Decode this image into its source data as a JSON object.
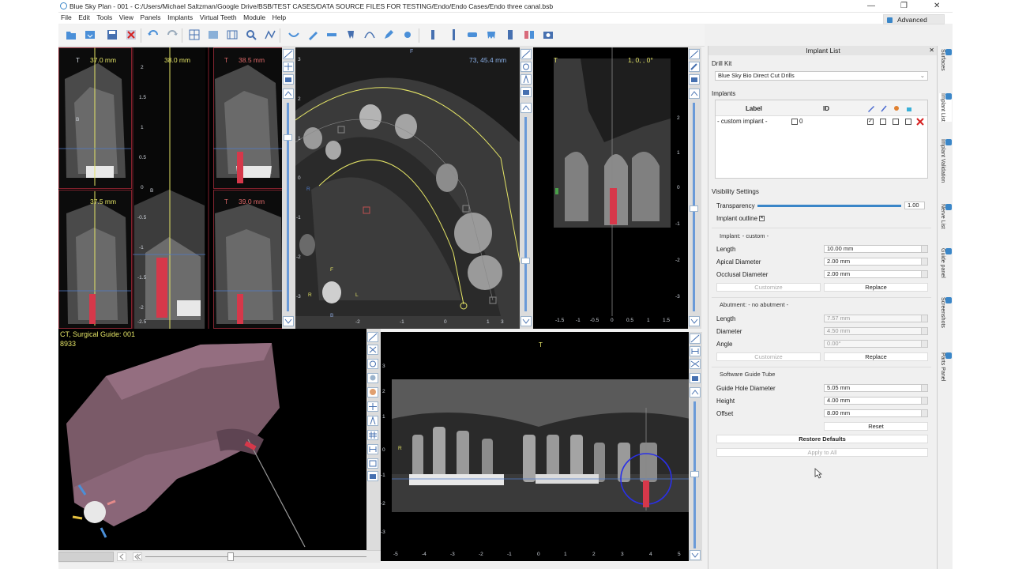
{
  "window": {
    "title": "Blue Sky Plan - 001 - C:/Users/Michael Saltzman/Google Drive/BSB/TEST CASES/DATA SOURCE FILES FOR TESTING/Endo/Endo Cases/Endo three canal.bsb",
    "minimize": "—",
    "restore": "❐",
    "close": "✕"
  },
  "menu": [
    "File",
    "Edit",
    "Tools",
    "View",
    "Panels",
    "Implants",
    "Virtual Teeth",
    "Module",
    "Help"
  ],
  "advanced_label": "Advanced",
  "views": {
    "cross": {
      "measures": [
        "37.0 mm",
        "38.0 mm",
        "38.5 mm",
        "37.5 mm",
        "39.0 mm"
      ],
      "t": "T",
      "b": "B",
      "ticks": [
        "2",
        "1.5",
        "1",
        "0.5",
        "0",
        "-0.5",
        "-1",
        "-1.5",
        "-2",
        "-2.5"
      ]
    },
    "axial": {
      "coord": "73, 45.4 mm",
      "f": "F",
      "r": "R",
      "l": "L",
      "b": "B",
      "ticks_x": [
        "-2",
        "-1",
        "0",
        "1",
        "2",
        "3"
      ],
      "ticks_y": [
        "3",
        "2",
        "1",
        "0",
        "-1",
        "-2",
        "-3"
      ]
    },
    "sagittal": {
      "coord": "1, 0, , 0°",
      "t": "T",
      "ticks_x": [
        "-1.5",
        "-1",
        "-0.5",
        "0",
        "0.5",
        "1",
        "1.5"
      ],
      "ticks_y": [
        "2",
        "1",
        "0",
        "-1",
        "-2",
        "-3"
      ]
    },
    "model3d": {
      "line1": "CT, Surgical Guide: 001",
      "line2": "8933"
    },
    "panoramic": {
      "t": "T",
      "r": "R",
      "ticks_x": [
        "-5",
        "-4",
        "-3",
        "-2",
        "-1",
        "0",
        "1",
        "2",
        "3",
        "4",
        "5"
      ],
      "ticks_y": [
        "3",
        "2",
        "1",
        "0",
        "-1",
        "-2",
        "-3"
      ]
    }
  },
  "panel": {
    "title": "Implant List",
    "drill_kit_label": "Drill Kit",
    "drill_kit_value": "Blue Sky Bio Direct Cut Drills",
    "implants_label": "Implants",
    "col_label": "Label",
    "col_id": "ID",
    "implant_row_label": "- custom implant -",
    "implant_row_id": "0",
    "visibility_title": "Visibility Settings",
    "transparency_label": "Transparency",
    "transparency_value": "1.00",
    "transparency_level": 1.0,
    "outline_label": "Implant outline",
    "implant_section": "Implant: - custom -",
    "length_label": "Length",
    "length_value": "10.00 mm",
    "apical_label": "Apical Diameter",
    "apical_value": "2.00 mm",
    "occlusal_label": "Occlusal Diameter",
    "occlusal_value": "2.00 mm",
    "customize": "Customize",
    "replace": "Replace",
    "abutment_section": "Abutment: - no abutment -",
    "ab_length_label": "Length",
    "ab_length_value": "7.57 mm",
    "ab_diameter_label": "Diameter",
    "ab_diameter_value": "4.50 mm",
    "ab_angle_label": "Angle",
    "ab_angle_value": "0.00°",
    "tube_section": "Software Guide Tube",
    "hole_label": "Guide Hole Diameter",
    "hole_value": "5.05 mm",
    "height_label": "Height",
    "height_value": "4.00 mm",
    "offset_label": "Offset",
    "offset_value": "8.00 mm",
    "reset": "Reset",
    "restore_defaults": "Restore Defaults",
    "apply_all": "Apply to All",
    "close": "✕"
  },
  "side_tabs": [
    "Surfaces",
    "Implant List",
    "Implant Validation",
    "Nerve List",
    "Guide panel",
    "Screenshots",
    "Parts Panel"
  ],
  "colors": {
    "accent": "#3a86c8",
    "implant": "#d6384a",
    "measure_yellow": "#e4e466",
    "delete": "#d62020"
  }
}
